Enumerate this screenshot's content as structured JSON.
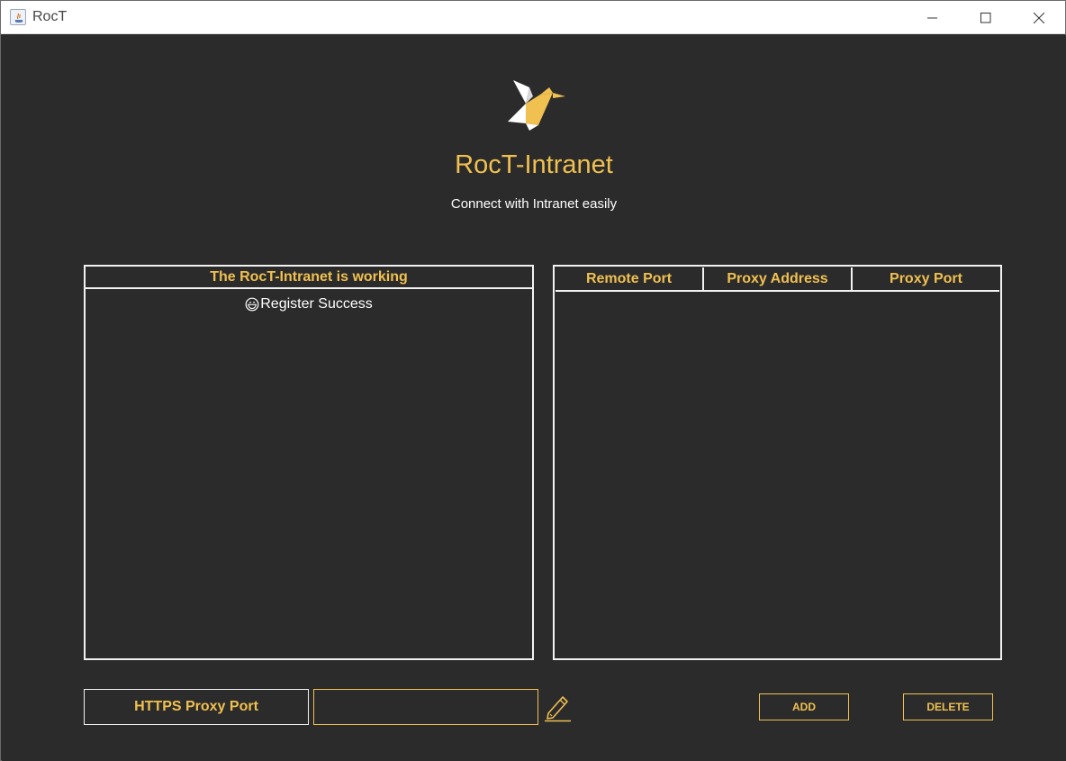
{
  "window": {
    "title": "RocT"
  },
  "header": {
    "app_name": "RocT-Intranet",
    "tagline": "Connect with Intranet easily"
  },
  "log_panel": {
    "title": "The RocT-Intranet is working",
    "entries": [
      {
        "icon": "smiley-icon",
        "text": "Register Success"
      }
    ]
  },
  "proxy_table": {
    "columns": [
      "Remote Port",
      "Proxy Address",
      "Proxy Port"
    ],
    "rows": []
  },
  "controls": {
    "proxy_port_label": "HTTPS Proxy Port",
    "proxy_port_value": "",
    "add_label": "ADD",
    "delete_label": "DELETE"
  },
  "colors": {
    "accent": "#f0c050",
    "background": "#2b2b2b",
    "border": "#f2f2f2",
    "text": "#ffffff"
  }
}
